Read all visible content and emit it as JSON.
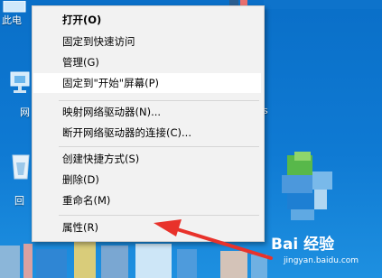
{
  "desktop": {
    "icons": [
      {
        "label": "此电",
        "icon": "this-pc-icon"
      },
      {
        "label": "网",
        "icon": "network-icon"
      },
      {
        "label": "回",
        "icon": "recycle-bin-icon"
      }
    ],
    "right_fragment": "s"
  },
  "context_menu": {
    "items": [
      {
        "label": "打开(O)",
        "bold": true
      },
      {
        "label": "固定到快速访问"
      },
      {
        "label": "管理(G)"
      },
      {
        "label": "固定到\"开始\"屏幕(P)",
        "highlighted": true
      },
      {
        "label": "映射网络驱动器(N)..."
      },
      {
        "label": "断开网络驱动器的连接(C)..."
      },
      {
        "label": "创建快捷方式(S)"
      },
      {
        "label": "删除(D)"
      },
      {
        "label": "重命名(M)"
      },
      {
        "label": "属性(R)"
      }
    ]
  },
  "annotation": {
    "arrow_color": "#e8322b",
    "target": "属性(R)"
  },
  "watermark": {
    "brand": "Bai 经验",
    "domain": "jingyan.baidu.com"
  }
}
